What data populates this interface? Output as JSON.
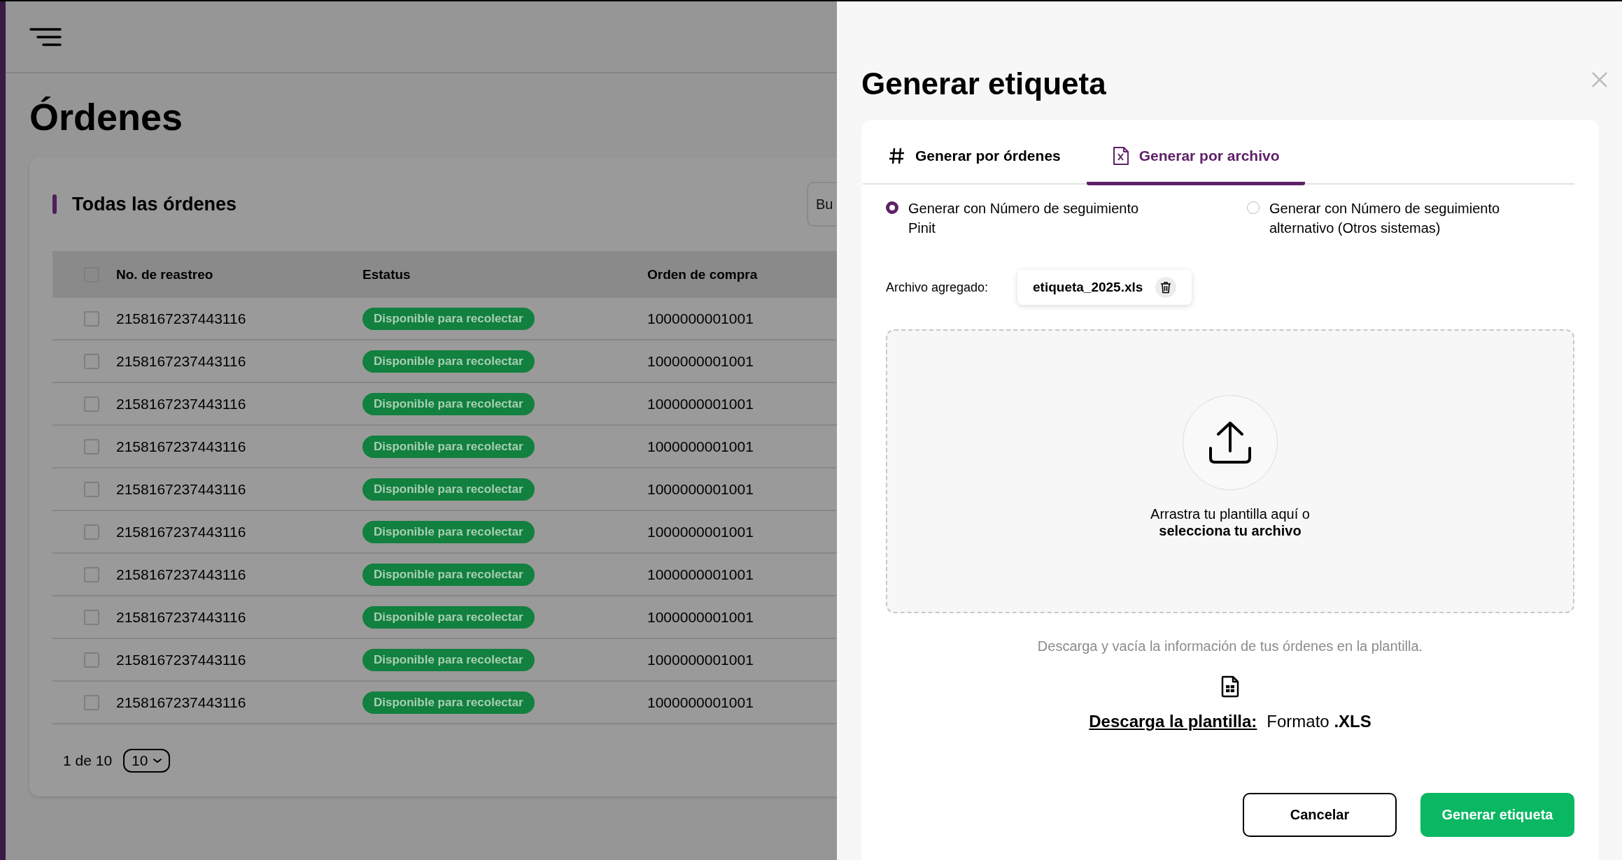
{
  "page": {
    "title": "Órdenes"
  },
  "orders_card": {
    "title": "Todas las órdenes",
    "search": {
      "placeholder": "Bu"
    },
    "table": {
      "header_checked": false,
      "columns": [
        "No. de reastreo",
        "Estatus",
        "Orden de compra"
      ],
      "rows": [
        {
          "checked": false,
          "tracking": "2158167237443116",
          "status": "Disponible para recolectar",
          "order": "1000000001001"
        },
        {
          "checked": false,
          "tracking": "2158167237443116",
          "status": "Disponible para recolectar",
          "order": "1000000001001"
        },
        {
          "checked": false,
          "tracking": "2158167237443116",
          "status": "Disponible para recolectar",
          "order": "1000000001001"
        },
        {
          "checked": false,
          "tracking": "2158167237443116",
          "status": "Disponible para recolectar",
          "order": "1000000001001"
        },
        {
          "checked": false,
          "tracking": "2158167237443116",
          "status": "Disponible para recolectar",
          "order": "1000000001001"
        },
        {
          "checked": false,
          "tracking": "2158167237443116",
          "status": "Disponible para recolectar",
          "order": "1000000001001"
        },
        {
          "checked": false,
          "tracking": "2158167237443116",
          "status": "Disponible para recolectar",
          "order": "1000000001001"
        },
        {
          "checked": false,
          "tracking": "2158167237443116",
          "status": "Disponible para recolectar",
          "order": "1000000001001"
        },
        {
          "checked": false,
          "tracking": "2158167237443116",
          "status": "Disponible para recolectar",
          "order": "1000000001001"
        },
        {
          "checked": false,
          "tracking": "2158167237443116",
          "status": "Disponible para recolectar",
          "order": "1000000001001"
        }
      ]
    },
    "pagination": {
      "range": "1 de 10",
      "page_size": "10"
    }
  },
  "drawer": {
    "title": "Generar etiqueta",
    "tabs": [
      {
        "label": "Generar por órdenes",
        "kind": "hash",
        "selected": false
      },
      {
        "label": "Generar por archivo",
        "kind": "file",
        "selected": true
      }
    ],
    "options": [
      {
        "label": "Generar con Número de seguimiento Pinit",
        "selected": true
      },
      {
        "label": "Generar con Número de seguimiento alternativo (Otros sistemas)",
        "selected": false
      }
    ],
    "file": {
      "label": "Archivo agregado:",
      "name": "etiqueta_2025.xls"
    },
    "dropzone": {
      "text": "Arrastra tu plantilla aquí o",
      "action": "selecciona tu archivo"
    },
    "hint": "Descarga y vacía la información de tus órdenes en la plantilla.",
    "download": {
      "link": "Descarga la plantilla:",
      "format": "Formato **.XLS**"
    },
    "buttons": [
      {
        "label": "Cancelar",
        "kind": "secondary"
      },
      {
        "label": "Generar etiqueta",
        "kind": "primary"
      }
    ]
  }
}
